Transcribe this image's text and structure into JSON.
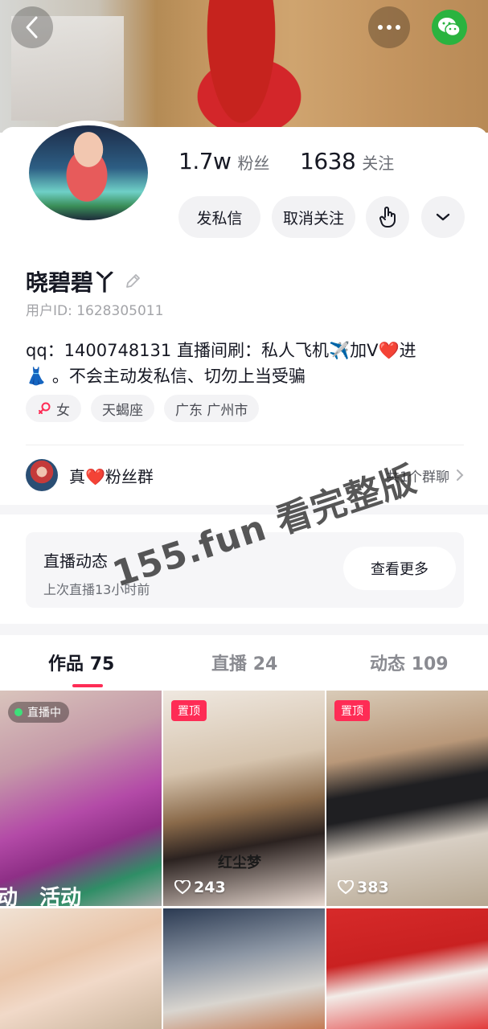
{
  "header": {
    "back_icon": "chevron-left-icon",
    "more_icon": "ellipsis-icon",
    "share_icon": "wechat-icon"
  },
  "profile": {
    "followers_count": "1.7w",
    "followers_label": "粉丝",
    "following_count": "1638",
    "following_label": "关注",
    "message_button": "发私信",
    "unfollow_button": "取消关注",
    "name": "晓碧碧丫",
    "user_id": "用户ID: 1628305011",
    "bio_line1": "qq：1400748131 直播间刷：私人飞机✈️加V❤️进",
    "bio_line2": "👗 。不会主动发私信、切勿上当受骗",
    "tags": {
      "gender": "女",
      "zodiac": "天蝎座",
      "location": "广东 广州市"
    },
    "gender_color": "#fe2c55"
  },
  "group": {
    "title": "真❤️粉丝群",
    "count": "共1个群聊"
  },
  "live_section": {
    "title": "直播动态",
    "subtitle": "上次直播13小时前",
    "button": "查看更多"
  },
  "tabs": [
    {
      "label": "作品",
      "count": "75"
    },
    {
      "label": "直播",
      "count": "24"
    },
    {
      "label": "动态",
      "count": "109"
    }
  ],
  "grid": {
    "tile1_badge": "直播中",
    "tile1_caption": "动   活动",
    "tile2_badge": "置顶",
    "tile2_caption": "红尘梦",
    "tile2_likes": "243",
    "tile3_badge": "置顶",
    "tile3_likes": "383"
  },
  "watermark": "155.fun 看完整版",
  "colors": {
    "accent": "#fe2c55",
    "wechat": "#2ab33f"
  }
}
